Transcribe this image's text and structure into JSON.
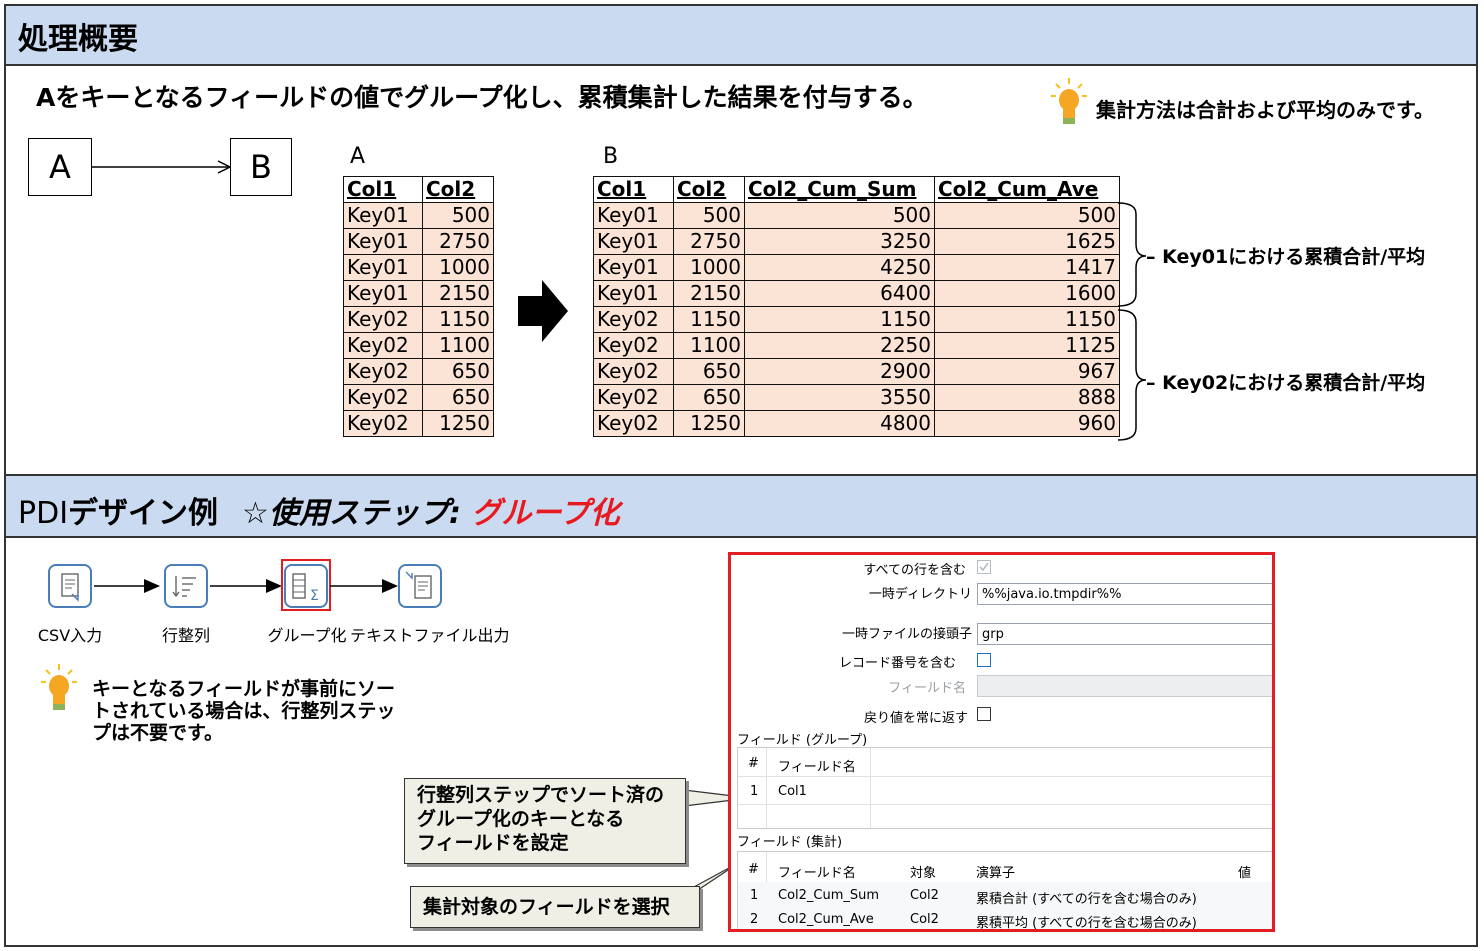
{
  "section1": {
    "title": "処理概要",
    "description": "Aをキーとなるフィールドの値でグループ化し、累積集計した結果を付与する。",
    "note": "集計方法は合計および平均のみです。",
    "flow": {
      "from": "A",
      "to": "B"
    }
  },
  "tableA": {
    "caption": "A",
    "headers": [
      "Col1",
      "Col2"
    ],
    "rows": [
      [
        "Key01",
        "500"
      ],
      [
        "Key01",
        "2750"
      ],
      [
        "Key01",
        "1000"
      ],
      [
        "Key01",
        "2150"
      ],
      [
        "Key02",
        "1150"
      ],
      [
        "Key02",
        "1100"
      ],
      [
        "Key02",
        "650"
      ],
      [
        "Key02",
        "650"
      ],
      [
        "Key02",
        "1250"
      ]
    ]
  },
  "tableB": {
    "caption": "B",
    "headers": [
      "Col1",
      "Col2",
      "Col2_Cum_Sum",
      "Col2_Cum_Ave"
    ],
    "rows": [
      [
        "Key01",
        "500",
        "500",
        "500"
      ],
      [
        "Key01",
        "2750",
        "3250",
        "1625"
      ],
      [
        "Key01",
        "1000",
        "4250",
        "1417"
      ],
      [
        "Key01",
        "2150",
        "6400",
        "1600"
      ],
      [
        "Key02",
        "1150",
        "1150",
        "1150"
      ],
      [
        "Key02",
        "1100",
        "2250",
        "1125"
      ],
      [
        "Key02",
        "650",
        "2900",
        "967"
      ],
      [
        "Key02",
        "650",
        "3550",
        "888"
      ],
      [
        "Key02",
        "1250",
        "4800",
        "960"
      ]
    ]
  },
  "brackets": {
    "key01": "Key01における累積合計/平均",
    "key02": "Key02における累積合計/平均"
  },
  "section2": {
    "title_prefix": "PDI",
    "title_main": "デザイン例",
    "step_prefix": "☆使用ステップ: ",
    "step_name": "グループ化",
    "steps": [
      "CSV入力",
      "行整列",
      "グループ化",
      "テキストファイル出力"
    ],
    "note": "キーとなるフィールドが事前にソートされている場合は、行整列ステップは不要です。",
    "note_lines": [
      "キーとなるフィールドが事前にソー",
      "トされている場合は、行整列ステッ",
      "プは不要です。"
    ],
    "callout1": [
      "行整列ステップでソート済の",
      "グループ化のキーとなる",
      "フィールドを設定"
    ],
    "callout2": "集計対象のフィールドを選択"
  },
  "dialog": {
    "include_all_rows_label": "すべての行を含む",
    "include_all_rows": true,
    "temp_dir_label": "一時ディレクトリ",
    "temp_dir_value": "%%java.io.tmpdir%%",
    "temp_prefix_label": "一時ファイルの接頭子",
    "temp_prefix_value": "grp",
    "include_row_num_label": "レコード番号を含む",
    "include_row_num": false,
    "field_name_label": "フィールド名",
    "field_name_value": "",
    "always_return_label": "戻り値を常に返す",
    "always_return": false,
    "group_section_label": "フィールド (グループ)",
    "group_headers": [
      "#",
      "フィールド名"
    ],
    "group_rows": [
      [
        "1",
        "Col1"
      ]
    ],
    "agg_section_label": "フィールド (集計)",
    "agg_headers": [
      "#",
      "フィールド名",
      "対象",
      "演算子",
      "値"
    ],
    "agg_rows": [
      [
        "1",
        "Col2_Cum_Sum",
        "Col2",
        "累積合計 (すべての行を含む場合のみ)",
        ""
      ],
      [
        "2",
        "Col2_Cum_Ave",
        "Col2",
        "累積平均 (すべての行を含む場合のみ)",
        ""
      ]
    ]
  }
}
